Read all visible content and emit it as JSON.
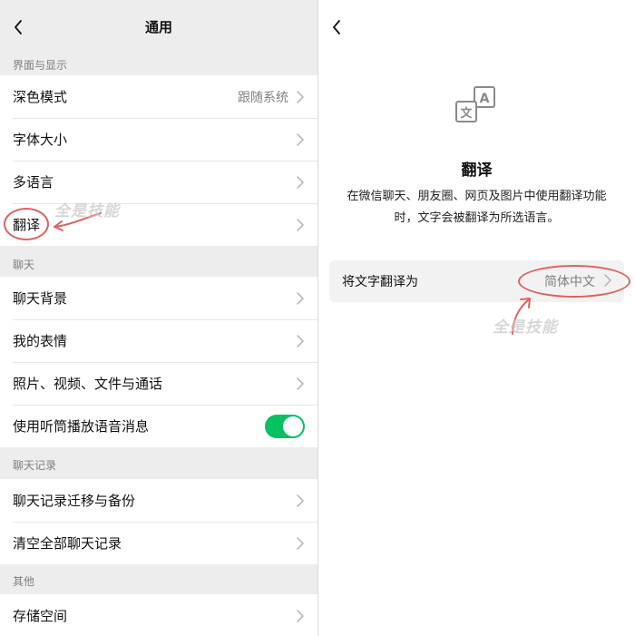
{
  "left": {
    "title": "通用",
    "sections": [
      {
        "header": "界面与显示",
        "rows": [
          {
            "label": "深色模式",
            "value": "跟随系统"
          },
          {
            "label": "字体大小"
          },
          {
            "label": "多语言"
          },
          {
            "label": "翻译"
          }
        ]
      },
      {
        "header": "聊天",
        "rows": [
          {
            "label": "聊天背景"
          },
          {
            "label": "我的表情"
          },
          {
            "label": "照片、视频、文件与通话"
          },
          {
            "label": "使用听筒播放语音消息",
            "toggle": true
          }
        ]
      },
      {
        "header": "聊天记录",
        "rows": [
          {
            "label": "聊天记录迁移与备份"
          },
          {
            "label": "清空全部聊天记录"
          }
        ]
      },
      {
        "header": "其他",
        "rows": [
          {
            "label": "存储空间"
          }
        ]
      }
    ]
  },
  "right": {
    "title": "翻译",
    "description": "在微信聊天、朋友圈、网页及图片中使用翻译功能时，文字会被翻译为所选语言。",
    "translate_row": {
      "label": "将文字翻译为",
      "value": "简体中文"
    },
    "icon_letters": {
      "back": "A",
      "front": "文"
    }
  },
  "watermark": "全是技能",
  "colors": {
    "toggle_on": "#07c160",
    "annotation": "#e06060",
    "background": "#ededed"
  },
  "icons": {
    "back": "chevron-left-icon",
    "chevron": "chevron-right-icon",
    "translate": "translate-icon"
  }
}
